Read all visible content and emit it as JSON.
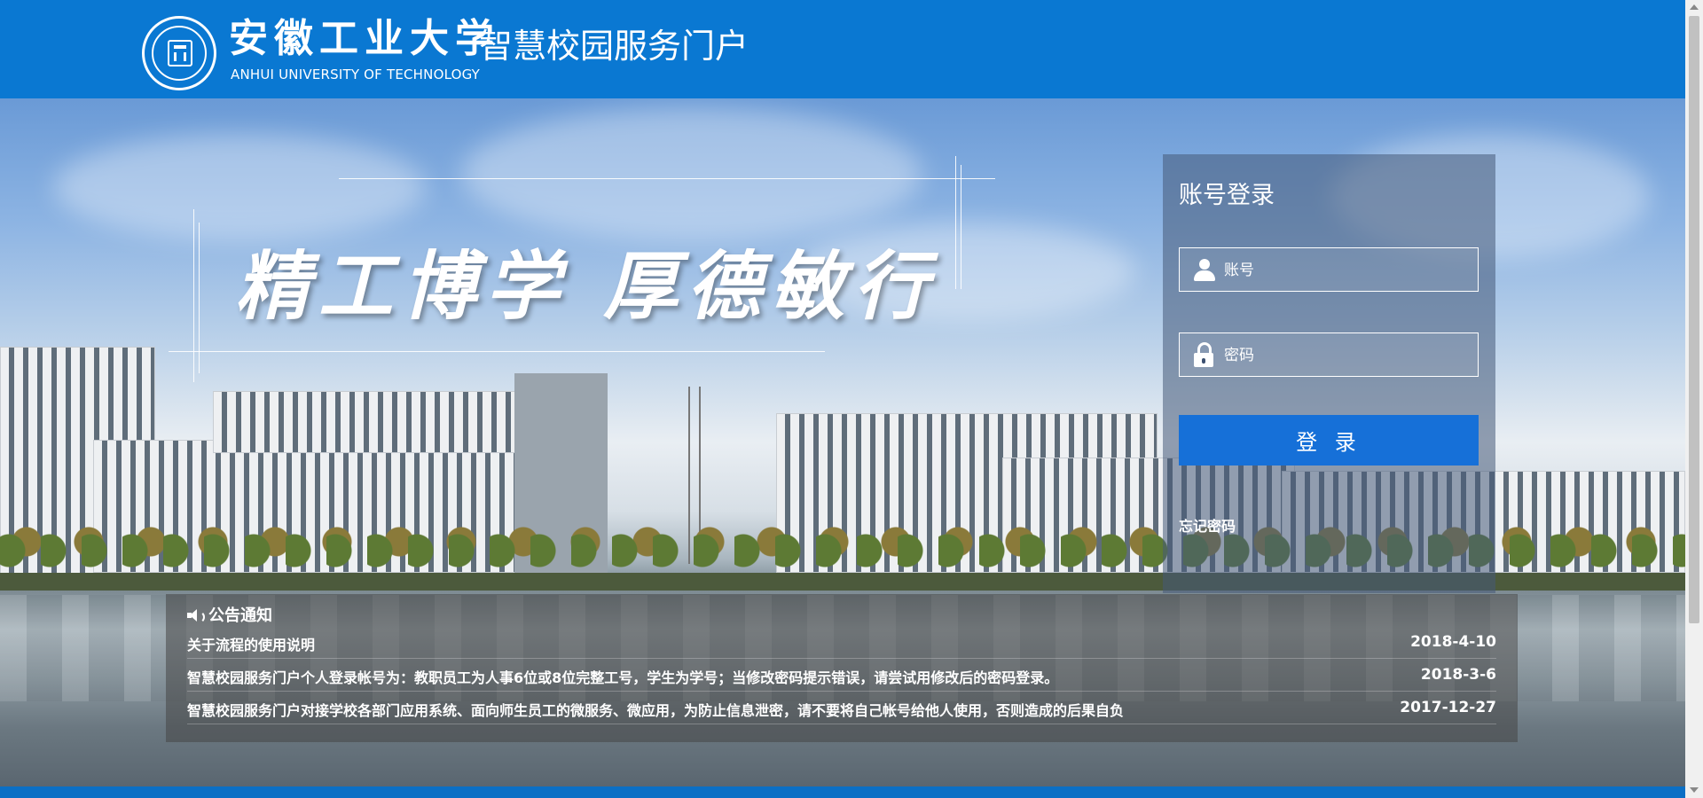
{
  "header": {
    "university_cn": "安徽工业大学",
    "university_en": "ANHUI UNIVERSITY OF TECHNOLOGY",
    "portal_title": "智慧校园服务门户",
    "logo_icon": "university-seal-icon",
    "bg_color": "#0a78d2"
  },
  "hero": {
    "motto": "精工博学 厚德敏行"
  },
  "login": {
    "title": "账号登录",
    "username_placeholder": "账号",
    "password_placeholder": "密码",
    "submit_label": "登 录",
    "forgot_label": "忘记密码",
    "button_color": "#1670d8"
  },
  "notice": {
    "heading": "公告通知",
    "items": [
      {
        "title": "关于流程的使用说明",
        "date": "2018-4-10"
      },
      {
        "title": "智慧校园服务门户个人登录帐号为：教职员工为人事6位或8位完整工号，学生为学号；当修改密码提示错误，请尝试用修改后的密码登录。",
        "date": "2018-3-6"
      },
      {
        "title": "智慧校园服务门户对接学校各部门应用系统、面向师生员工的微服务、微应用，为防止信息泄密，请不要将自己帐号给他人使用，否则造成的后果自负",
        "date": "2017-12-27"
      }
    ]
  }
}
